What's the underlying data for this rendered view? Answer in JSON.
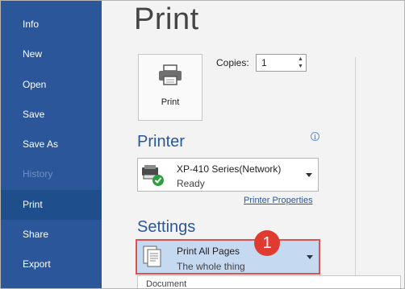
{
  "sidebar": {
    "items": [
      {
        "label": "Info",
        "state": "normal"
      },
      {
        "label": "New",
        "state": "normal"
      },
      {
        "label": "Open",
        "state": "normal"
      },
      {
        "label": "Save",
        "state": "normal"
      },
      {
        "label": "Save As",
        "state": "normal"
      },
      {
        "label": "History",
        "state": "disabled"
      },
      {
        "label": "Print",
        "state": "active"
      },
      {
        "label": "Share",
        "state": "normal"
      },
      {
        "label": "Export",
        "state": "normal"
      }
    ]
  },
  "main": {
    "title": "Print",
    "print_button_label": "Print",
    "copies": {
      "label": "Copies:",
      "value": "1"
    },
    "printer": {
      "heading": "Printer",
      "info_icon": "i",
      "name": "XP-410 Series(Network)",
      "status": "Ready",
      "properties_link": "Printer Properties"
    },
    "settings": {
      "heading": "Settings",
      "option_name": "Print All Pages",
      "option_desc": "The whole thing",
      "callout_number": "1",
      "dropdown_header": "Document"
    }
  },
  "colors": {
    "sidebar_bg": "#2b579a",
    "sidebar_active": "#1e4e8c",
    "accent": "#2b579a",
    "selected_bg": "#c5d9f1",
    "callout": "#e03b30",
    "status_check": "#2e9e3f"
  }
}
